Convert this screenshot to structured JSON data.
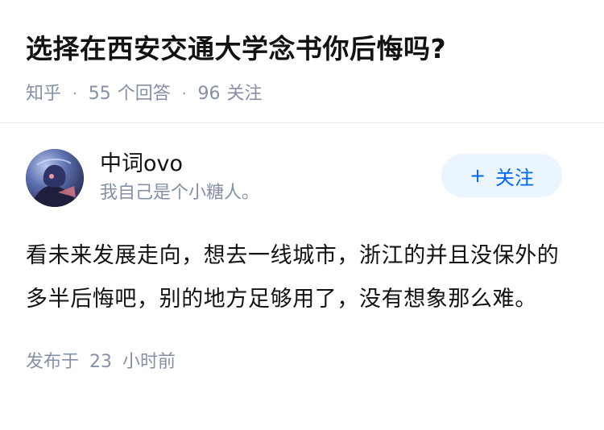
{
  "question": {
    "title": "选择在西安交通大学念书你后悔吗?",
    "source": "知乎",
    "answers_count": "55",
    "answers_label": "个回答",
    "follow_count": "96",
    "follow_label": "关注"
  },
  "answer": {
    "author_name": "中词ovo",
    "author_bio": "我自己是个小糖人。",
    "follow_button": {
      "icon": "+",
      "label": "关注"
    },
    "content": "看未来发展走向，想去一线城市，浙江的并且没保外的多半后悔吧，别的地方足够用了，没有想象那么难。",
    "publish_prefix": "发布于",
    "publish_num": "23",
    "publish_suffix": "小时前"
  },
  "colors": {
    "meta_gray": "#8590a6",
    "follow_bg": "#ebf5ff",
    "follow_text": "#0066ff"
  }
}
